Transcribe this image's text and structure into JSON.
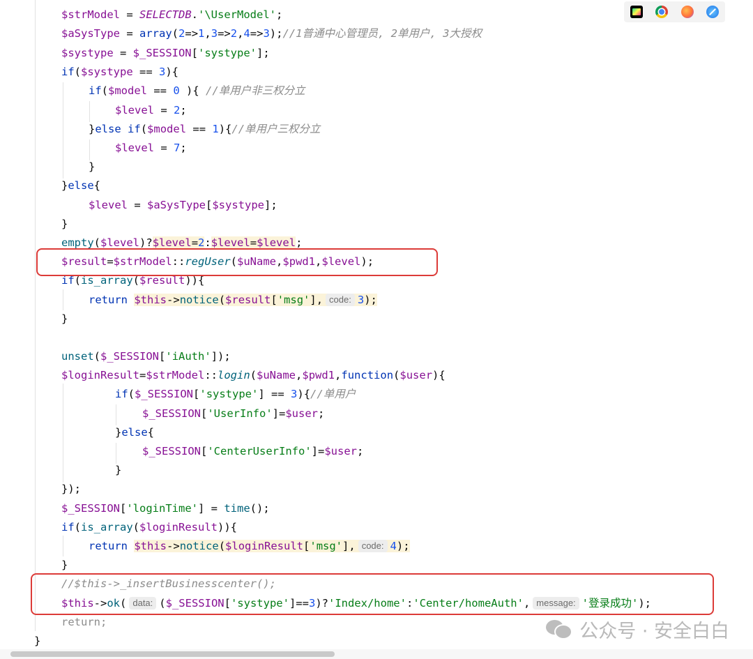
{
  "toolbar": {
    "icons": [
      "phpstorm-icon",
      "chrome-icon",
      "firefox-icon",
      "safari-icon"
    ]
  },
  "code": {
    "l1": {
      "a": "$strModel",
      "b": " = ",
      "c": "SELECTDB",
      "d": ".",
      "e": "'\\UserModel'",
      "f": ";"
    },
    "l2": {
      "a": "$aSysType",
      "b": " = ",
      "c": "array",
      "d": "(",
      "n1": "2",
      "o1": "=>",
      "n2": "1",
      "o2": ",",
      "n3": "3",
      "o3": "=>",
      "n4": "2",
      "o4": ",",
      "n5": "4",
      "o5": "=>",
      "n6": "3",
      "e": ");",
      "cm": "//1普通中心管理员, 2单用户, 3大授权"
    },
    "l3": {
      "a": "$systype",
      "b": " = ",
      "c": "$_SESSION",
      "d": "[",
      "e": "'systype'",
      "f": "];"
    },
    "l4": {
      "a": "if",
      "b": "(",
      "c": "$systype",
      "d": " == ",
      "e": "3",
      "f": "){"
    },
    "l5": {
      "a": "if",
      "b": "(",
      "c": "$model",
      "d": " == ",
      "e": "0",
      "f": " ){ ",
      "cm": "//单用户非三权分立"
    },
    "l6": {
      "a": "$level",
      "b": " = ",
      "c": "2",
      "d": ";"
    },
    "l7": {
      "a": "}",
      "b": "else",
      "c": " ",
      "d": "if",
      "e": "(",
      "f": "$model",
      "g": " == ",
      "h": "1",
      "i": "){",
      "cm": "//单用户三权分立"
    },
    "l8": {
      "a": "$level",
      "b": " = ",
      "c": "7",
      "d": ";"
    },
    "l9": {
      "a": "}"
    },
    "l10": {
      "a": "}",
      "b": "else",
      "c": "{"
    },
    "l11": {
      "a": "$level",
      "b": " = ",
      "c": "$aSysType",
      "d": "[",
      "e": "$systype",
      "f": "];"
    },
    "l12": {
      "a": "}"
    },
    "l13": {
      "a": "empty",
      "b": "(",
      "c": "$level",
      "d": ")?",
      "e": "$level",
      "f": "=",
      "g": "2",
      "h": ":",
      "i": "$level",
      "j": "=",
      "k": "$level",
      "l": ";"
    },
    "l14": {
      "a": "$result",
      "b": "=",
      "c": "$strModel",
      "d": "::",
      "e": "regUser",
      "f": "(",
      "g": "$uName",
      "h": ",",
      "i": "$pwd1",
      "j": ",",
      "k": "$level",
      "l": ");"
    },
    "l15": {
      "a": "if",
      "b": "(",
      "c": "is_array",
      "d": "(",
      "e": "$result",
      "f": ")){"
    },
    "l16": {
      "a": "return",
      "b": " ",
      "c": "$this",
      "d": "->",
      "e": "notice",
      "f": "(",
      "g": "$result",
      "h": "[",
      "i": "'msg'",
      "j": "],",
      "hint": "code:",
      "k": "3",
      "l": ");"
    },
    "l17": {
      "a": "}"
    },
    "l18": {
      "a": "unset",
      "b": "(",
      "c": "$_SESSION",
      "d": "[",
      "e": "'iAuth'",
      "f": "]);"
    },
    "l19": {
      "a": "$loginResult",
      "b": "=",
      "c": "$strModel",
      "d": "::",
      "e": "login",
      "f": "(",
      "g": "$uName",
      "h": ",",
      "i": "$pwd1",
      "j": ",",
      "k": "function",
      "l": "(",
      "m": "$user",
      "n": "){"
    },
    "l20": {
      "a": "if",
      "b": "(",
      "c": "$_SESSION",
      "d": "[",
      "e": "'systype'",
      "f": "] == ",
      "g": "3",
      "h": "){",
      "cm": "//单用户"
    },
    "l21": {
      "a": "$_SESSION",
      "b": "[",
      "c": "'UserInfo'",
      "d": "]=",
      "e": "$user",
      "f": ";"
    },
    "l22": {
      "a": "}",
      "b": "else",
      "c": "{"
    },
    "l23": {
      "a": "$_SESSION",
      "b": "[",
      "c": "'CenterUserInfo'",
      "d": "]=",
      "e": "$user",
      "f": ";"
    },
    "l24": {
      "a": "}"
    },
    "l25": {
      "a": "});"
    },
    "l26": {
      "a": "$_SESSION",
      "b": "[",
      "c": "'loginTime'",
      "d": "] = ",
      "e": "time",
      "f": "();"
    },
    "l27": {
      "a": "if",
      "b": "(",
      "c": "is_array",
      "d": "(",
      "e": "$loginResult",
      "f": ")){"
    },
    "l28": {
      "a": "return",
      "b": " ",
      "c": "$this",
      "d": "->",
      "e": "notice",
      "f": "(",
      "g": "$loginResult",
      "h": "[",
      "i": "'msg'",
      "j": "],",
      "hint": "code:",
      "k": "4",
      "l": ");"
    },
    "l29": {
      "a": "}"
    },
    "l30": {
      "cm": "//$this->_insertBusinesscenter();"
    },
    "l31": {
      "a": "$this",
      "b": "->",
      "c": "ok",
      "d": "(",
      "hint1": "data:",
      "e": "(",
      "f": "$_SESSION",
      "g": "[",
      "h": "'systype'",
      "i": "]==",
      "j": "3",
      "k": ")?",
      "l": "'Index/home'",
      "m": ":",
      "n": "'Center/homeAuth'",
      "o": ",",
      "hint2": "message:",
      "p": "'登录成功'",
      "q": ");"
    },
    "l32": {
      "a": "return",
      "b": ";"
    },
    "l33": {
      "a": "}"
    }
  },
  "watermark": {
    "text": "公众号 · 安全白白"
  }
}
